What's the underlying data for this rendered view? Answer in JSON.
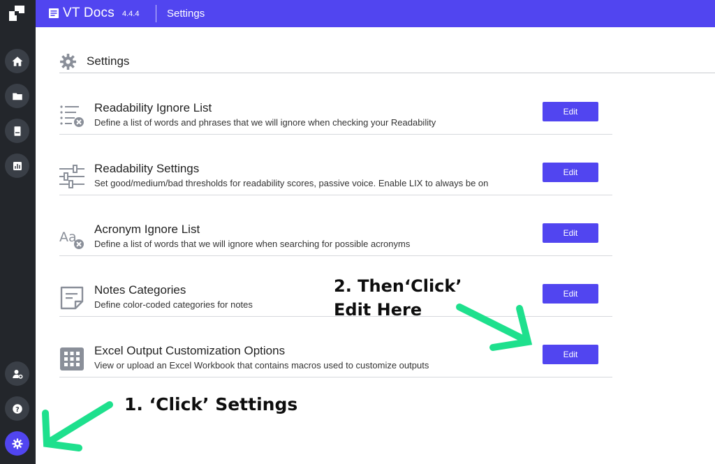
{
  "app": {
    "name": "VT Docs",
    "version": "4.4.4",
    "section": "Settings"
  },
  "page": {
    "title": "Settings"
  },
  "rows": [
    {
      "title": "Readability Ignore List",
      "description": "Define a list of words and phrases that we will ignore when checking your Readability",
      "button": "Edit",
      "icon": "list-ignore-icon"
    },
    {
      "title": "Readability Settings",
      "description": "Set good/medium/bad thresholds for readability scores, passive voice. Enable LIX to always be on",
      "button": "Edit",
      "icon": "sliders-icon"
    },
    {
      "title": "Acronym Ignore List",
      "description": "Define a list of words that we will ignore when searching for possible acronyms",
      "button": "Edit",
      "icon": "acronym-icon"
    },
    {
      "title": "Notes Categories",
      "description": "Define color-coded categories for notes",
      "button": "Edit",
      "icon": "note-icon"
    },
    {
      "title": "Excel Output Customization Options",
      "description": "View or upload an Excel Workbook that contains macros used to customize outputs",
      "button": "Edit",
      "icon": "grid-icon"
    }
  ],
  "annotations": {
    "step1": "1. ‘Click’ Settings",
    "step2_line1": "2. Then‘Click’",
    "step2_line2": "Edit Here"
  },
  "colors": {
    "accent": "#5145f0",
    "sidebar": "#23262b",
    "arrow": "#1ee08d"
  }
}
